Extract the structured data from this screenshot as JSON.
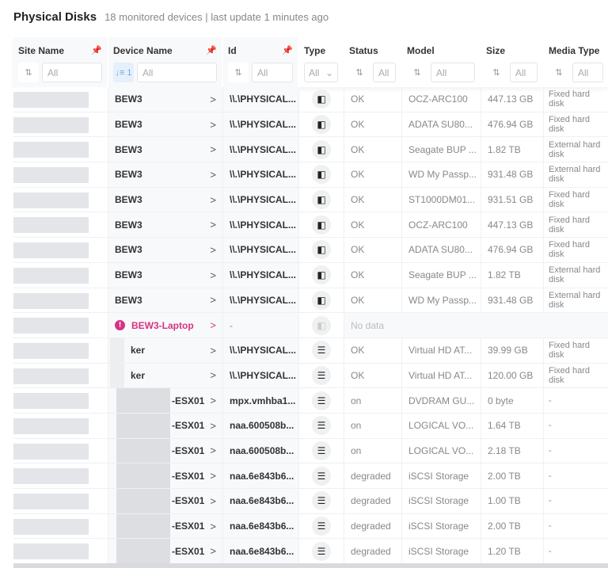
{
  "title": "Physical Disks",
  "subtitle": "18 monitored devices | last update 1 minutes ago",
  "columns": [
    {
      "label": "Site Name",
      "filter": "All"
    },
    {
      "label": "Device Name",
      "filter": "All",
      "sort": "1"
    },
    {
      "label": "Id",
      "filter": "All"
    },
    {
      "label": "Type",
      "filter": "All"
    },
    {
      "label": "Status",
      "filter": "All"
    },
    {
      "label": "Model",
      "filter": "All"
    },
    {
      "label": "Size",
      "filter": "All"
    },
    {
      "label": "Media Type",
      "filter": "All"
    }
  ],
  "rows": [
    {
      "device": "BEW3",
      "id": "\\\\.\\PHYSICAL...",
      "type": "ssd",
      "status": "OK",
      "model": "OCZ-ARC100",
      "size": "447.13 GB",
      "media": "Fixed hard disk"
    },
    {
      "device": "BEW3",
      "id": "\\\\.\\PHYSICAL...",
      "type": "ssd",
      "status": "OK",
      "model": "ADATA SU80...",
      "size": "476.94 GB",
      "media": "Fixed hard disk"
    },
    {
      "device": "BEW3",
      "id": "\\\\.\\PHYSICAL...",
      "type": "ssd",
      "status": "OK",
      "model": "Seagate BUP ...",
      "size": "1.82 TB",
      "media": "External hard disk"
    },
    {
      "device": "BEW3",
      "id": "\\\\.\\PHYSICAL...",
      "type": "ssd",
      "status": "OK",
      "model": "WD My Passp...",
      "size": "931.48 GB",
      "media": "External hard disk"
    },
    {
      "device": "BEW3",
      "id": "\\\\.\\PHYSICAL...",
      "type": "ssd",
      "status": "OK",
      "model": "ST1000DM01...",
      "size": "931.51 GB",
      "media": "Fixed hard disk"
    },
    {
      "device": "BEW3",
      "id": "\\\\.\\PHYSICAL...",
      "type": "ssd",
      "status": "OK",
      "model": "OCZ-ARC100",
      "size": "447.13 GB",
      "media": "Fixed hard disk"
    },
    {
      "device": "BEW3",
      "id": "\\\\.\\PHYSICAL...",
      "type": "ssd",
      "status": "OK",
      "model": "ADATA SU80...",
      "size": "476.94 GB",
      "media": "Fixed hard disk"
    },
    {
      "device": "BEW3",
      "id": "\\\\.\\PHYSICAL...",
      "type": "ssd",
      "status": "OK",
      "model": "Seagate BUP ...",
      "size": "1.82 TB",
      "media": "External hard disk"
    },
    {
      "device": "BEW3",
      "id": "\\\\.\\PHYSICAL...",
      "type": "ssd",
      "status": "OK",
      "model": "WD My Passp...",
      "size": "931.48 GB",
      "media": "External hard disk"
    },
    {
      "device": "BEW3-Laptop",
      "id": "-",
      "type": "ssd",
      "status": "No data",
      "model": "",
      "size": "",
      "media": "",
      "error": true
    },
    {
      "device": "ker",
      "id": "\\\\.\\PHYSICAL...",
      "type": "server",
      "status": "OK",
      "model": "Virtual HD AT...",
      "size": "39.99 GB",
      "media": "Fixed hard disk",
      "blurred": "short"
    },
    {
      "device": "ker",
      "id": "\\\\.\\PHYSICAL...",
      "type": "server",
      "status": "OK",
      "model": "Virtual HD AT...",
      "size": "120.00 GB",
      "media": "Fixed hard disk",
      "blurred": "short"
    },
    {
      "device": "-ESX01",
      "id": "mpx.vmhba1...",
      "type": "server",
      "status": "on",
      "model": "DVDRAM GU...",
      "size": "0 byte",
      "media": "-",
      "blurred": "long"
    },
    {
      "device": "-ESX01",
      "id": "naa.600508b...",
      "type": "server",
      "status": "on",
      "model": "LOGICAL VO...",
      "size": "1.64 TB",
      "media": "-",
      "blurred": "long"
    },
    {
      "device": "-ESX01",
      "id": "naa.600508b...",
      "type": "server",
      "status": "on",
      "model": "LOGICAL VO...",
      "size": "2.18 TB",
      "media": "-",
      "blurred": "long"
    },
    {
      "device": "-ESX01",
      "id": "naa.6e843b6...",
      "type": "server",
      "status": "degraded",
      "model": "iSCSI Storage",
      "size": "2.00 TB",
      "media": "-",
      "blurred": "long"
    },
    {
      "device": "-ESX01",
      "id": "naa.6e843b6...",
      "type": "server",
      "status": "degraded",
      "model": "iSCSI Storage",
      "size": "1.00 TB",
      "media": "-",
      "blurred": "long"
    },
    {
      "device": "-ESX01",
      "id": "naa.6e843b6...",
      "type": "server",
      "status": "degraded",
      "model": "iSCSI Storage",
      "size": "2.00 TB",
      "media": "-",
      "blurred": "long"
    },
    {
      "device": "-ESX01",
      "id": "naa.6e843b6...",
      "type": "server",
      "status": "degraded",
      "model": "iSCSI Storage",
      "size": "1.20 TB",
      "media": "-",
      "blurred": "long"
    }
  ]
}
